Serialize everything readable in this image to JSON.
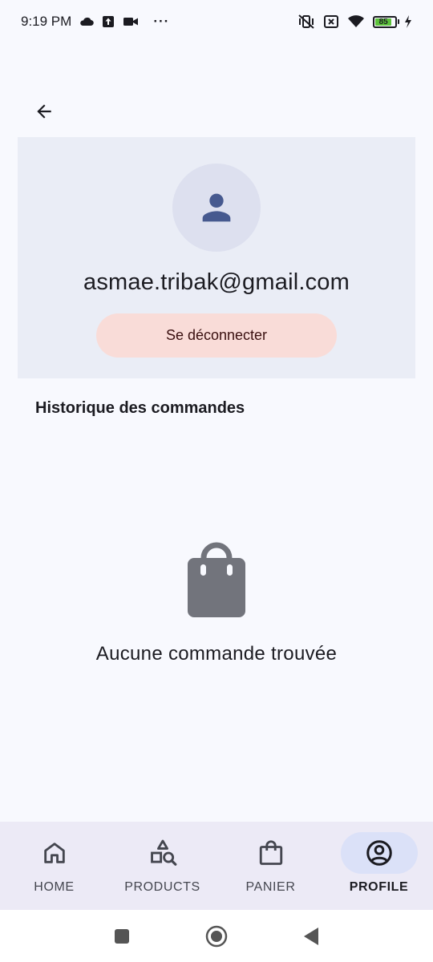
{
  "status_bar": {
    "time": "9:19 PM",
    "more_indicator": "···",
    "battery_level": "85",
    "left_icons": [
      "cloud-icon",
      "upload-icon",
      "video-icon"
    ],
    "right_icons": [
      "vibrate-off-icon",
      "no-sim-icon",
      "wifi-icon",
      "battery-icon",
      "charging-icon"
    ]
  },
  "header": {
    "back_icon": "arrow-left-icon"
  },
  "profile": {
    "avatar_icon": "person-icon",
    "email": "asmae.tribak@gmail.com",
    "logout_label": "Se déconnecter"
  },
  "orders": {
    "section_title": "Historique des commandes",
    "empty_icon": "shopping-bag-icon",
    "empty_message": "Aucune commande trouvée"
  },
  "bottom_nav": {
    "items": [
      {
        "label": "HOME",
        "icon": "home-icon",
        "active": false
      },
      {
        "label": "PRODUCTS",
        "icon": "shapes-search-icon",
        "active": false
      },
      {
        "label": "PANIER",
        "icon": "shopping-bag-icon",
        "active": false
      },
      {
        "label": "PROFILE",
        "icon": "account-circle-icon",
        "active": true
      }
    ]
  },
  "colors": {
    "background": "#f8f9fe",
    "card": "#eaedf6",
    "avatar_bg": "#dde0ef",
    "avatar_icon": "#46598f",
    "logout_bg": "#f9dcd8",
    "nav_bg": "#eceaf6",
    "nav_active_pill": "#dbe1f8",
    "empty_icon": "#72747c"
  }
}
